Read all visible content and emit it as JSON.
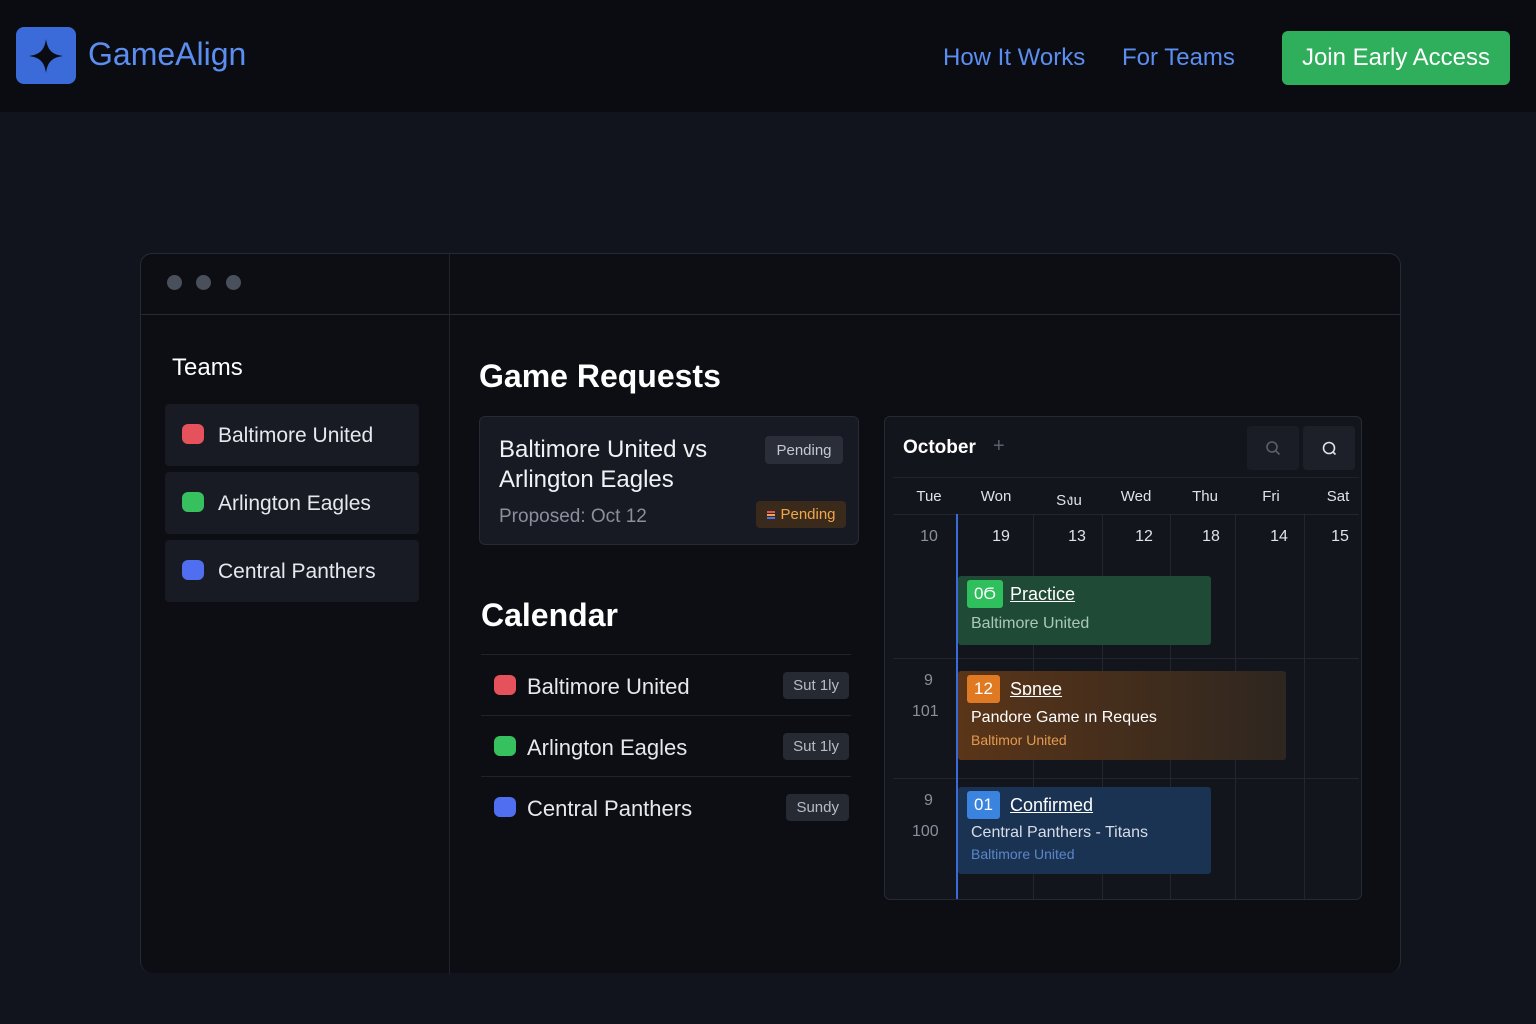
{
  "brand": {
    "name": "GameAlign",
    "logo_icon": "four-point-star-icon"
  },
  "nav": {
    "links": [
      "How It Works",
      "For Teams"
    ],
    "cta_label": "Join Early Access"
  },
  "sidebar": {
    "title": "Teams",
    "items": [
      {
        "label": "Baltimore United",
        "color": "#e5525b"
      },
      {
        "label": "Arlington Eagles",
        "color": "#36c15e"
      },
      {
        "label": "Central Panthers",
        "color": "#4f6ef0"
      }
    ]
  },
  "requests": {
    "title": "Game Requests",
    "card": {
      "matchup": "Baltimore United vs Arlington Eagles",
      "status_top": "Pending",
      "status_badge": "Pending",
      "proposed": "Proposed: Oct 12"
    }
  },
  "calendar_list": {
    "title": "Calendar",
    "rows": [
      {
        "label": "Baltimore United",
        "tag": "Sut 1ly",
        "color": "#e5525b"
      },
      {
        "label": "Arlington Eagles",
        "tag": "Sut 1ly",
        "color": "#36c15e"
      },
      {
        "label": "Central Panthers",
        "tag": "Sundy",
        "color": "#4f6ef0"
      }
    ]
  },
  "calendar": {
    "month": "October",
    "add_icon": "plus-icon",
    "search_icon": "search-icon",
    "refresh_icon": "refresh-icon",
    "days": [
      "Tue",
      "Won",
      "Sงu",
      "Wed",
      "Thu",
      "Fri",
      "Sat"
    ],
    "dates": [
      "10",
      "19",
      "13",
      "12",
      "18",
      "14",
      "15"
    ],
    "time_labels": [
      {
        "a": "9",
        "b": "101"
      },
      {
        "a": "9",
        "b": "100"
      }
    ],
    "events": [
      {
        "badge": "0Ϭ",
        "title": "Practice",
        "line1": "Baltimore United",
        "line2": "",
        "color": "#1f4a35",
        "badge_color": "#2fbf5c",
        "text_color": "#a9c9b6"
      },
      {
        "badge": "12",
        "title": "Sɒnee",
        "line1": "Pandore Game ın Reques",
        "line2": "Baltimor United",
        "color": "#4a2f1c",
        "badge_color": "#e07a22",
        "text_color": "#ffffff",
        "sub_color": "#e39a4f"
      },
      {
        "badge": "01",
        "title": "Confirmed",
        "line1": "Central Panthers - Titans",
        "line2": "Baltimore United",
        "color": "#1b3352",
        "badge_color": "#3a84e0",
        "text_color": "#d6dde8",
        "sub_color": "#5b86c9"
      }
    ]
  }
}
